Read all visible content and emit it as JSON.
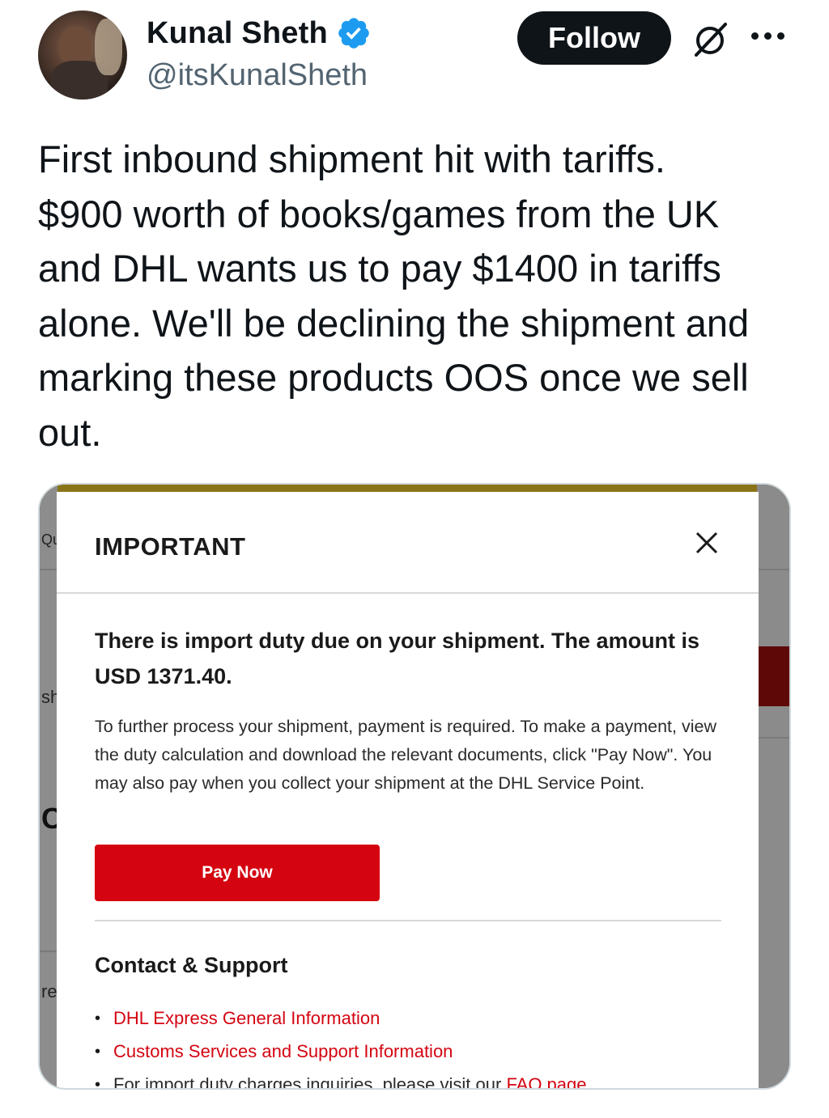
{
  "author": {
    "name": "Kunal Sheth",
    "handle": "@itsKunalSheth",
    "verified": true
  },
  "header": {
    "follow_label": "Follow",
    "icons": [
      "grok-icon",
      "more-icon"
    ]
  },
  "tweet": {
    "text": "First inbound shipment hit with tariffs.\n$900 worth of books/games from the UK\nand DHL wants us to pay $1400 in tariffs\nalone. We'll be declining the shipment and\nmarking these products OOS once we sell\nout."
  },
  "media": {
    "edge_fragments": [
      "Qu",
      "sh",
      "C",
      "re"
    ],
    "modal": {
      "title": "IMPORTANT",
      "duty_notice": "There is import duty due on your shipment. The amount is USD 1371.40.",
      "instructions": "To further process your shipment, payment is required. To make a payment, view the duty calculation and download the relevant documents, click \"Pay Now\". You may also pay when you collect your shipment at the DHL Service Point.",
      "pay_button": "Pay Now",
      "contact_title": "Contact & Support",
      "links": [
        {
          "text": "DHL Express General Information"
        },
        {
          "text": "Customs Services and Support Information"
        },
        {
          "prefix": "For import duty charges inquiries, please visit our ",
          "text": "FAQ page"
        }
      ]
    }
  },
  "colors": {
    "dhl_red": "#d40511",
    "verified_blue": "#1d9bf0",
    "text_primary": "#0f1419",
    "text_secondary": "#536471"
  }
}
